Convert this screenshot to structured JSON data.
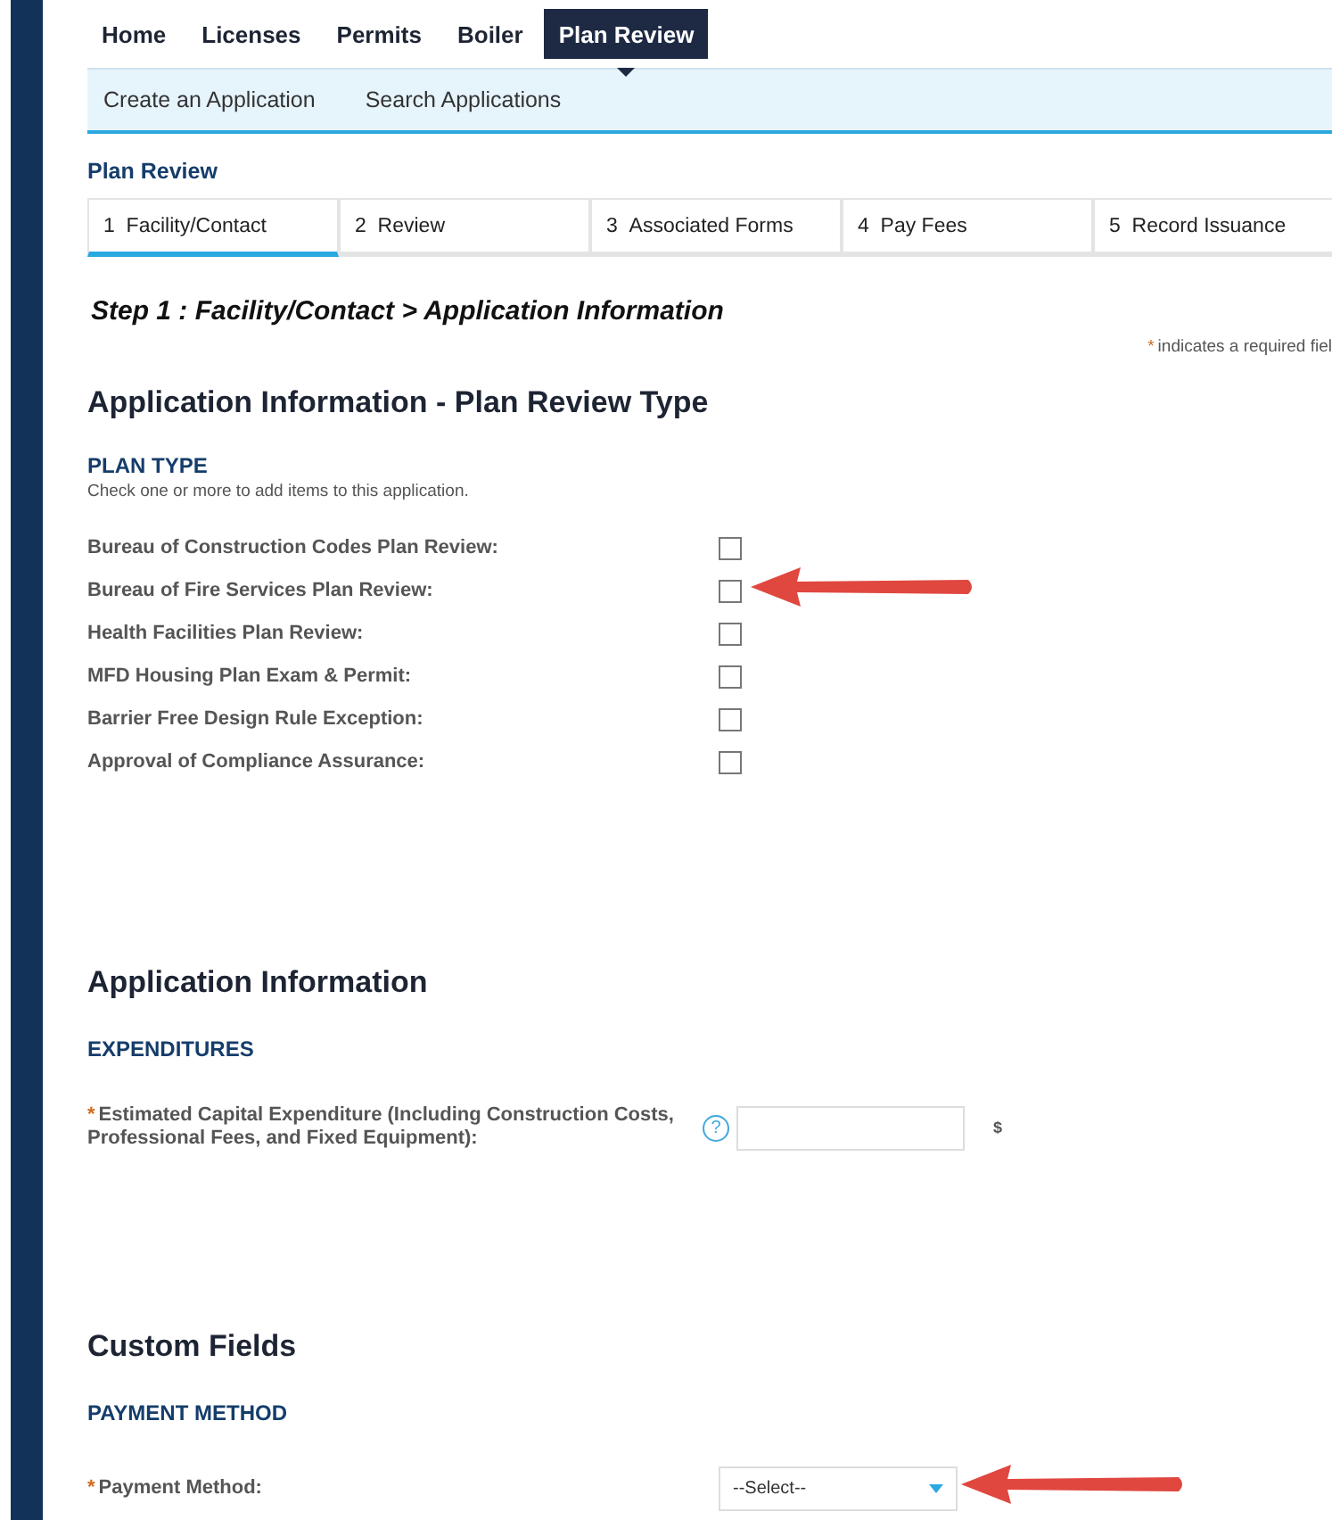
{
  "top_nav": [
    {
      "label": "Home",
      "selected": false
    },
    {
      "label": "Licenses",
      "selected": false
    },
    {
      "label": "Permits",
      "selected": false
    },
    {
      "label": "Boiler",
      "selected": false
    },
    {
      "label": "Plan Review",
      "selected": true
    }
  ],
  "sub_nav": [
    "Create an Application",
    "Search Applications"
  ],
  "page_title": "Plan Review",
  "steps": [
    {
      "number": "1",
      "label": "Facility/Contact",
      "selected": true
    },
    {
      "number": "2",
      "label": "Review",
      "selected": false
    },
    {
      "number": "3",
      "label": "Associated Forms",
      "selected": false
    },
    {
      "number": "4",
      "label": "Pay Fees",
      "selected": false
    },
    {
      "number": "5",
      "label": "Record Issuance",
      "selected": false
    }
  ],
  "step_heading": "Step 1 : Facility/Contact > Application Information",
  "required_note": {
    "mark": "*",
    "text": "indicates a required fiel"
  },
  "sections": [
    {
      "title": "Application Information - Plan Review Type",
      "subsection": "PLAN TYPE",
      "hint": "Check one or more to add items to this application.",
      "kind": "checkboxes",
      "items": [
        {
          "label": "Bureau of Construction Codes Plan Review:",
          "checked": false,
          "arrow": false
        },
        {
          "label": "Bureau of Fire Services Plan Review:",
          "checked": false,
          "arrow": true
        },
        {
          "label": "Health Facilities Plan Review:",
          "checked": false,
          "arrow": false
        },
        {
          "label": "MFD Housing Plan Exam & Permit:",
          "checked": false,
          "arrow": false
        },
        {
          "label": "Barrier Free Design Rule Exception:",
          "checked": false,
          "arrow": false
        },
        {
          "label": "Approval of Compliance Assurance:",
          "checked": false,
          "arrow": false
        }
      ]
    },
    {
      "title": "Application Information",
      "subsection": "EXPENDITURES",
      "kind": "money",
      "field": {
        "required": "*",
        "label": "Estimated Capital Expenditure (Including Construction Costs, Professional Fees, and Fixed Equipment):",
        "help": "?",
        "unit": "$",
        "arrow": false
      }
    },
    {
      "title": "Custom Fields",
      "subsection": "PAYMENT METHOD",
      "kind": "select",
      "field": {
        "required": "*",
        "label": "Payment Method:",
        "value": "--Select--",
        "arrow": true
      }
    }
  ]
}
